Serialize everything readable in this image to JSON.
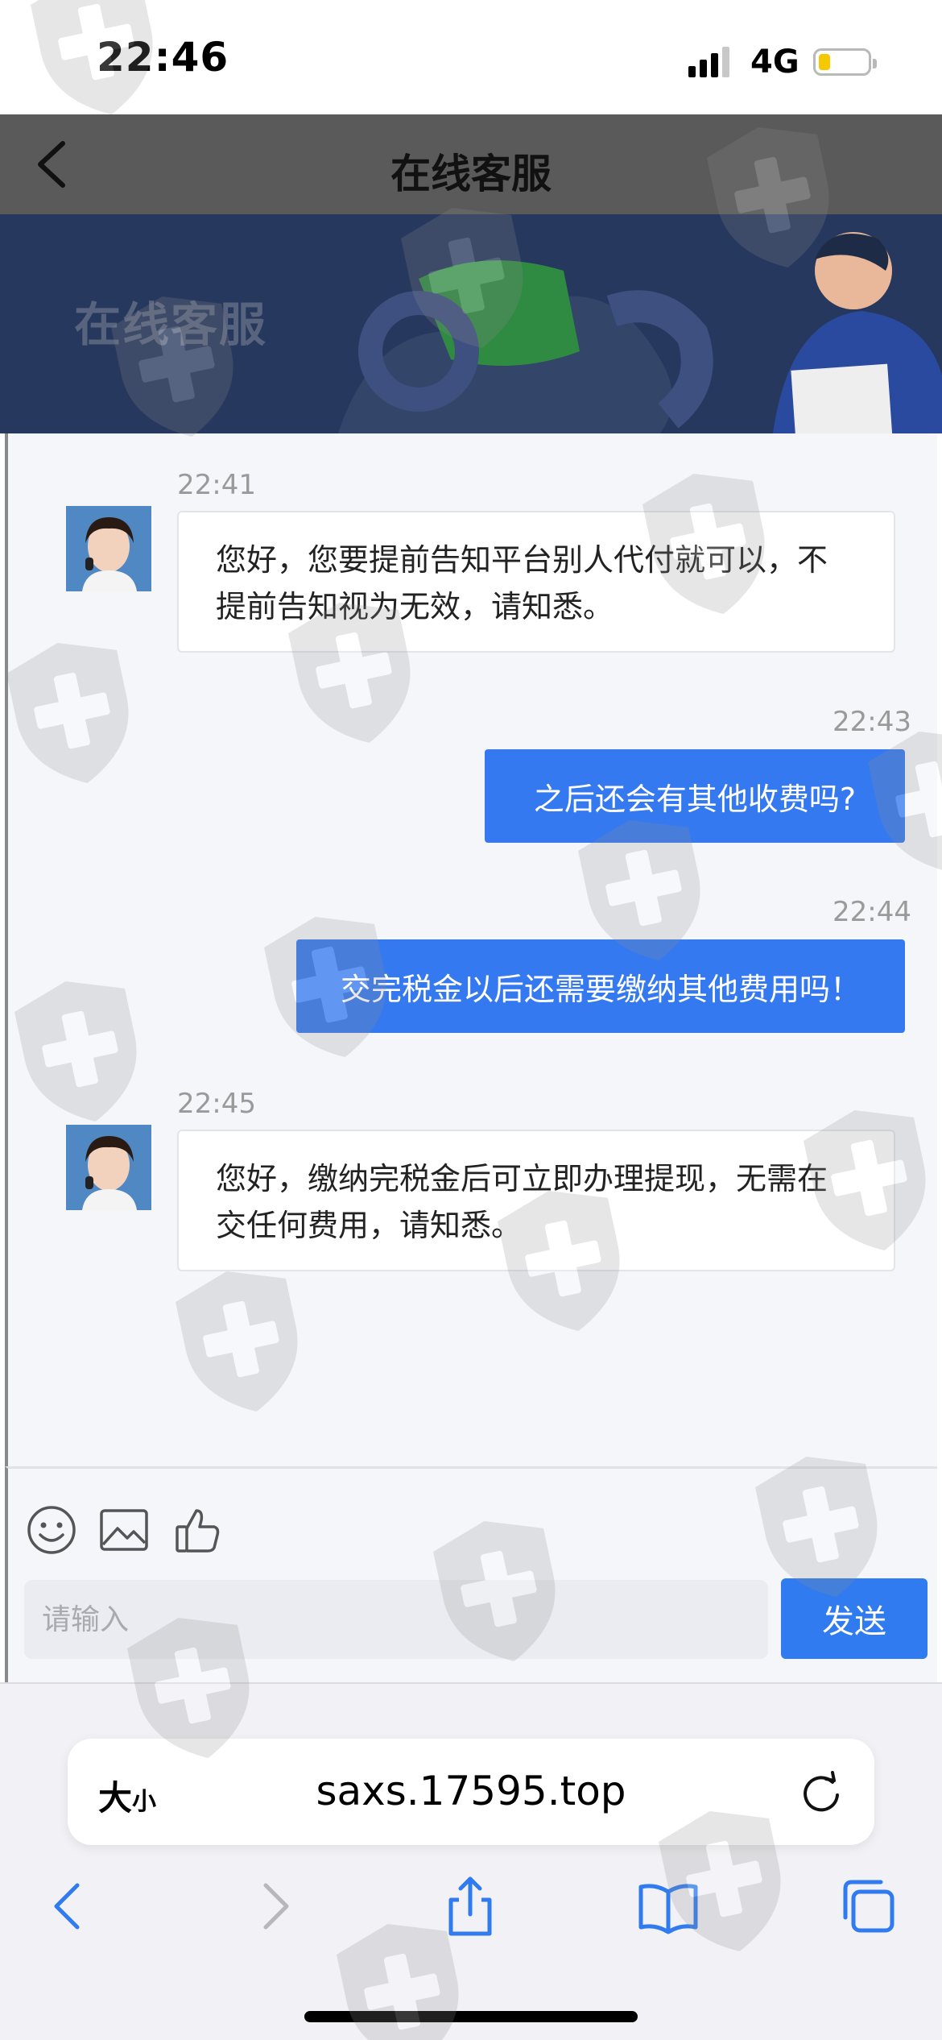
{
  "status_bar": {
    "time": "22:46",
    "network": "4G"
  },
  "nav": {
    "title": "在线客服"
  },
  "banner": {
    "text": "在线客服"
  },
  "messages": [
    {
      "time": "22:41",
      "text_line1": "您好，您要提前告知平台别人代付就可以，不",
      "text_line2": "提前告知视为无效，请知悉。"
    },
    {
      "time": "22:43",
      "text": "之后还会有其他收费吗?"
    },
    {
      "time": "22:44",
      "text": "交完税金以后还需要缴纳其他费用吗！"
    },
    {
      "time": "22:45",
      "text_line1": "您好，缴纳完税金后可立即办理提现，无需在",
      "text_line2": "交任何费用，请知悉。"
    }
  ],
  "composer": {
    "placeholder": "请输入",
    "send_label": "发送"
  },
  "safari": {
    "size_label_big": "大",
    "size_label_small": "小",
    "url": "saxs.17595.top"
  },
  "colors": {
    "accent": "#3479f0",
    "nav_bg": "#5a5a5a",
    "banner_bg": "#27385e"
  }
}
